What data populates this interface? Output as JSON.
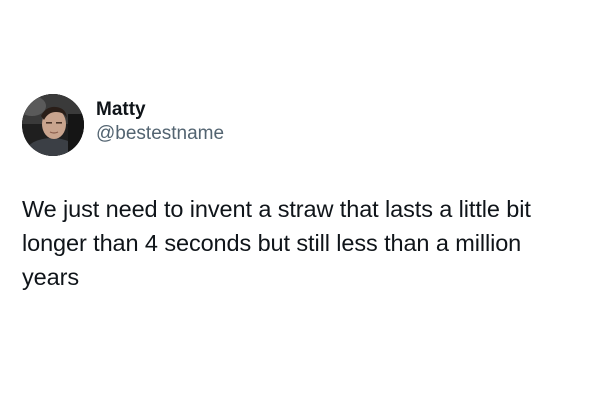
{
  "tweet": {
    "display_name": "Matty",
    "handle": "@bestestname",
    "text": "We just need to invent a straw that lasts a little bit longer than 4 seconds but still less than a million years"
  },
  "icons": {
    "avatar": "user-avatar-photo"
  }
}
